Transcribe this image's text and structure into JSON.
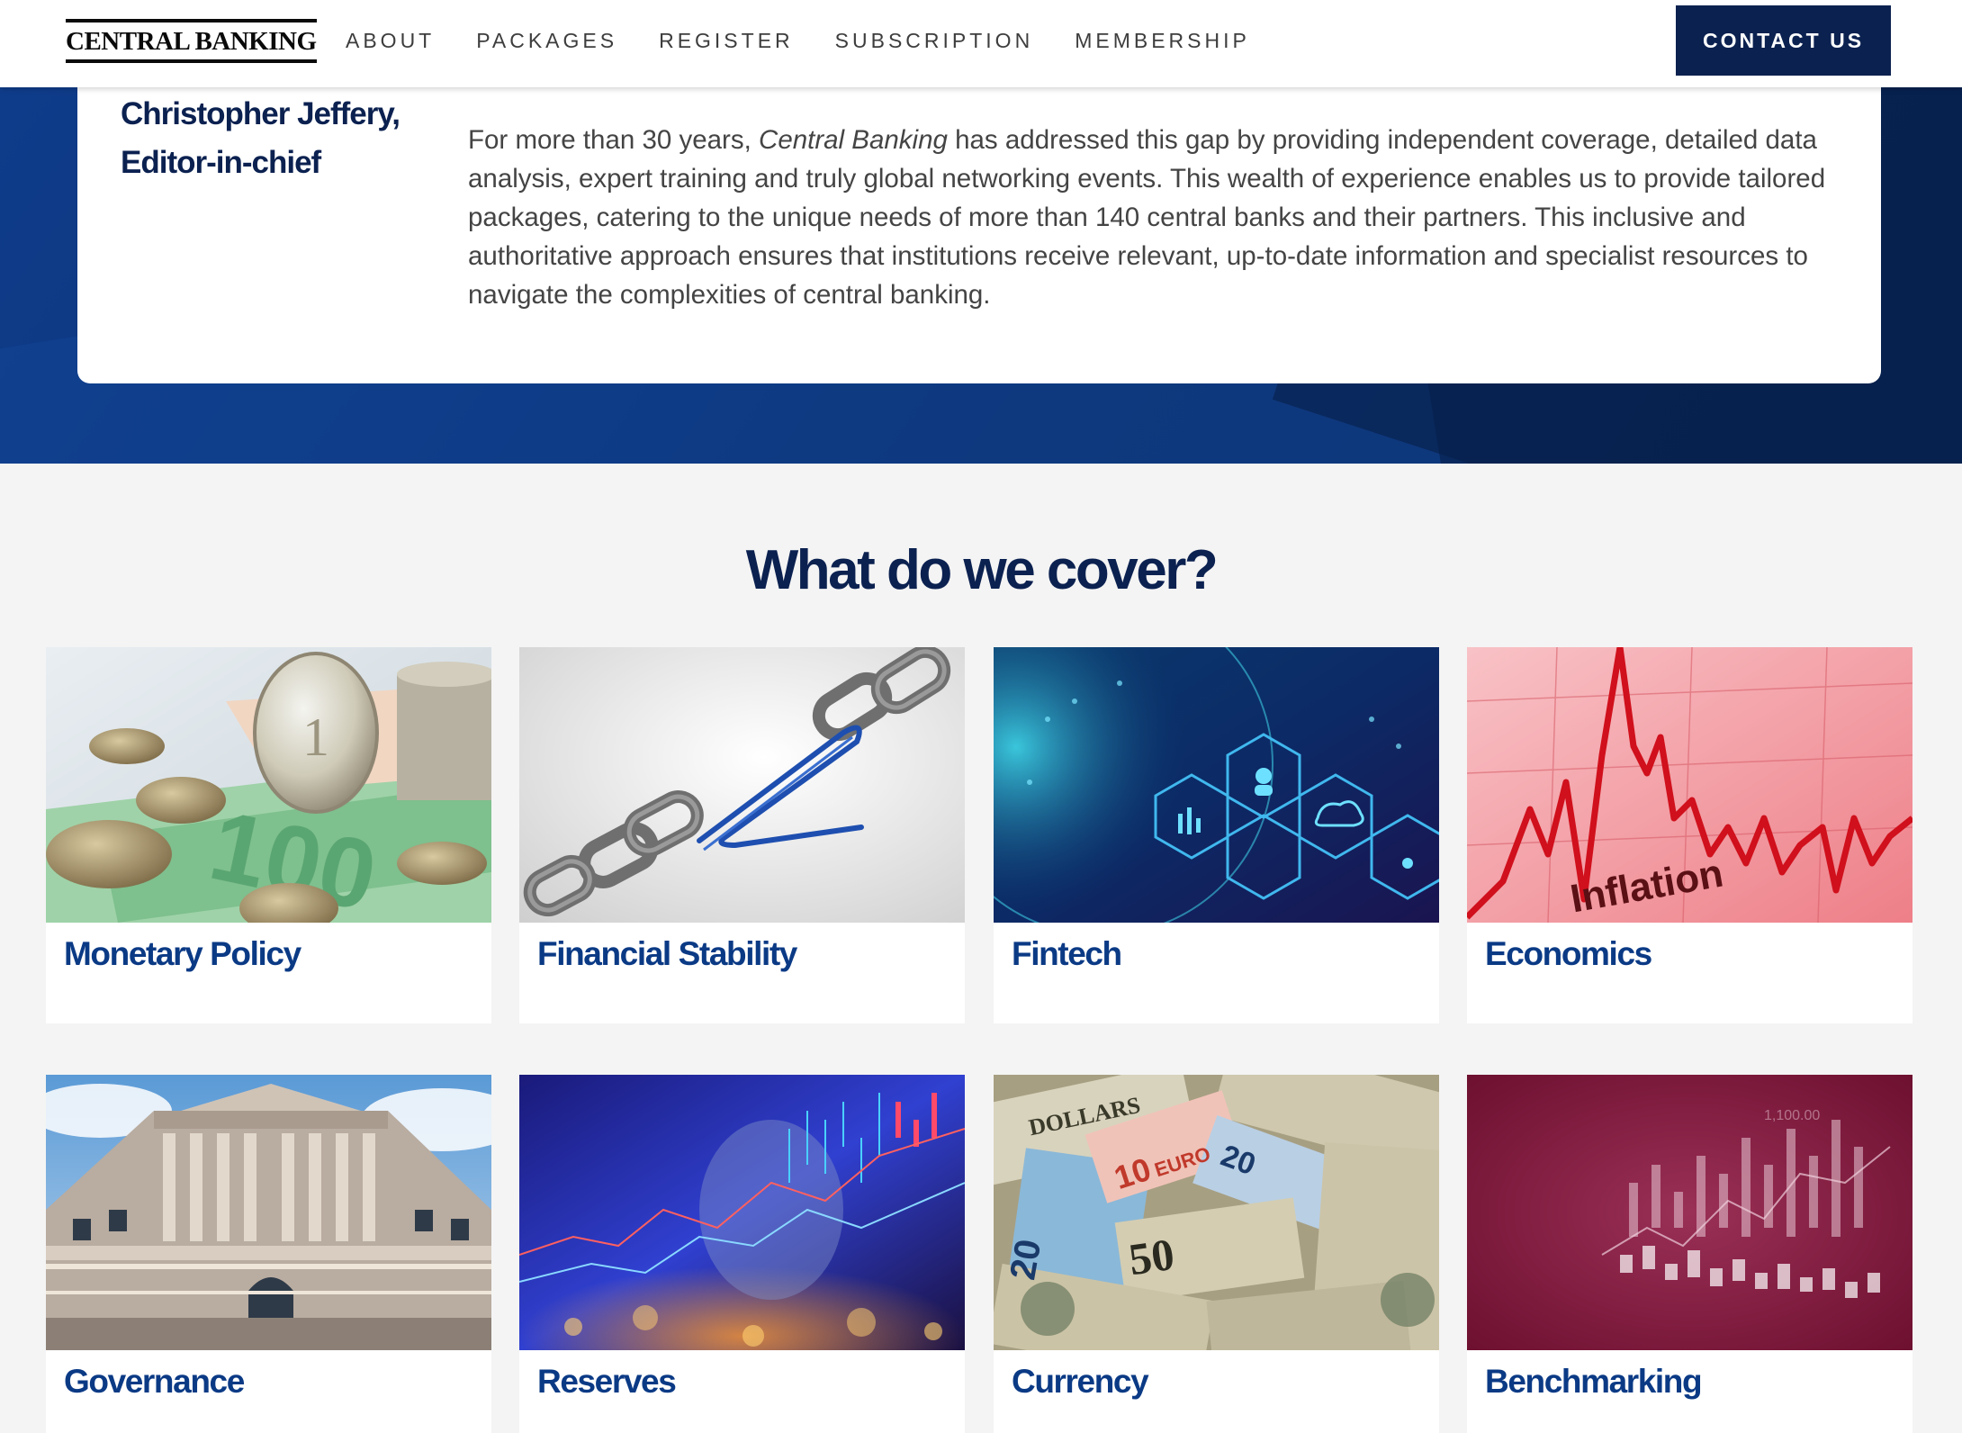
{
  "header": {
    "logo": "CENTRAL BANKING",
    "nav": [
      "ABOUT",
      "PACKAGES",
      "REGISTER",
      "SUBSCRIPTION",
      "MEMBERSHIP"
    ],
    "contact_label": "CONTACT US"
  },
  "intro": {
    "author_name": "Christopher Jeffery,",
    "author_title": "Editor-in-chief",
    "quote_prefix": "For more than 30 years, ",
    "quote_italic": "Central Banking",
    "quote_suffix": " has addressed this gap by providing independent coverage, detailed data analysis, expert training and truly global networking events. This wealth of experience enables us to provide tailored packages, catering to the unique needs of more than 140 central banks and their partners. This inclusive and authoritative approach ensures that institutions receive relevant, up-to-date information and specialist resources to navigate the complexities of central banking."
  },
  "cover": {
    "title": "What do we cover?",
    "topics": [
      {
        "label": "Monetary Policy",
        "image": "coins-and-banknotes"
      },
      {
        "label": "Financial Stability",
        "image": "chain-with-paperclip"
      },
      {
        "label": "Fintech",
        "image": "digital-network-globe"
      },
      {
        "label": "Economics",
        "image": "inflation-chart"
      },
      {
        "label": "Governance",
        "image": "bank-building"
      },
      {
        "label": "Reserves",
        "image": "dollar-market-chart"
      },
      {
        "label": "Currency",
        "image": "dollar-and-euro-notes"
      },
      {
        "label": "Benchmarking",
        "image": "candlestick-chart"
      }
    ],
    "image_texts": {
      "inflation": "Inflation",
      "euro": "EURO",
      "dollars": "DOLLARS"
    }
  },
  "colors": {
    "navy": "#0b2150",
    "tile_label": "#0b3a85",
    "hero": "#0c3278"
  }
}
